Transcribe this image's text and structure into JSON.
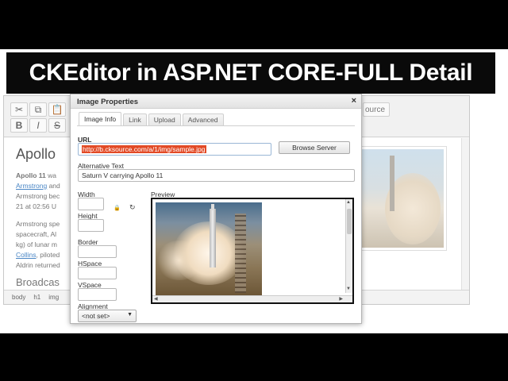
{
  "banner": {
    "title": "CKEditor in ASP.NET CORE-FULL Detail"
  },
  "toolbar": {
    "row1": [
      "✂",
      "⧉",
      "📋"
    ],
    "row2": [
      "B",
      "I",
      "S"
    ],
    "source_label": "ource"
  },
  "document": {
    "heading": "Apollo",
    "lines": [
      {
        "bold": "Apollo 11",
        "text": " wa"
      },
      {
        "link": "Armstrong",
        "text": " and"
      },
      {
        "text": "Armstrong bec"
      },
      {
        "text": "21 at 02:56 U"
      }
    ],
    "lines2": [
      {
        "text": "Armstrong spe"
      },
      {
        "text": "spacecraft, Al"
      },
      {
        "text": "kg) of lunar m"
      },
      {
        "link": "Collins",
        "text": ", piloted"
      },
      {
        "text": "Aldrin returned"
      }
    ],
    "subheading": "Broadcas",
    "status_path": [
      "body",
      "h1",
      "img"
    ]
  },
  "dialog": {
    "title": "Image Properties",
    "close": "×",
    "tabs": [
      "Image Info",
      "Link",
      "Upload",
      "Advanced"
    ],
    "active_tab": "Image Info",
    "url_label": "URL",
    "url_value": "http://b.cksource.com/a/1/img/sample.jpg",
    "browse_label": "Browse Server",
    "alt_label": "Alternative Text",
    "alt_value": "Saturn V carrying Apollo 11",
    "width_label": "Width",
    "height_label": "Height",
    "border_label": "Border",
    "hspace_label": "HSpace",
    "vspace_label": "VSpace",
    "alignment_label": "Alignment",
    "alignment_value": "<not set>",
    "preview_label": "Preview",
    "lock_icon": "🔒",
    "reset_icon": "↻"
  },
  "colors": {
    "selection": "#e24a26",
    "link": "#4a86c5",
    "banner_bg": "#0a0a0a"
  }
}
